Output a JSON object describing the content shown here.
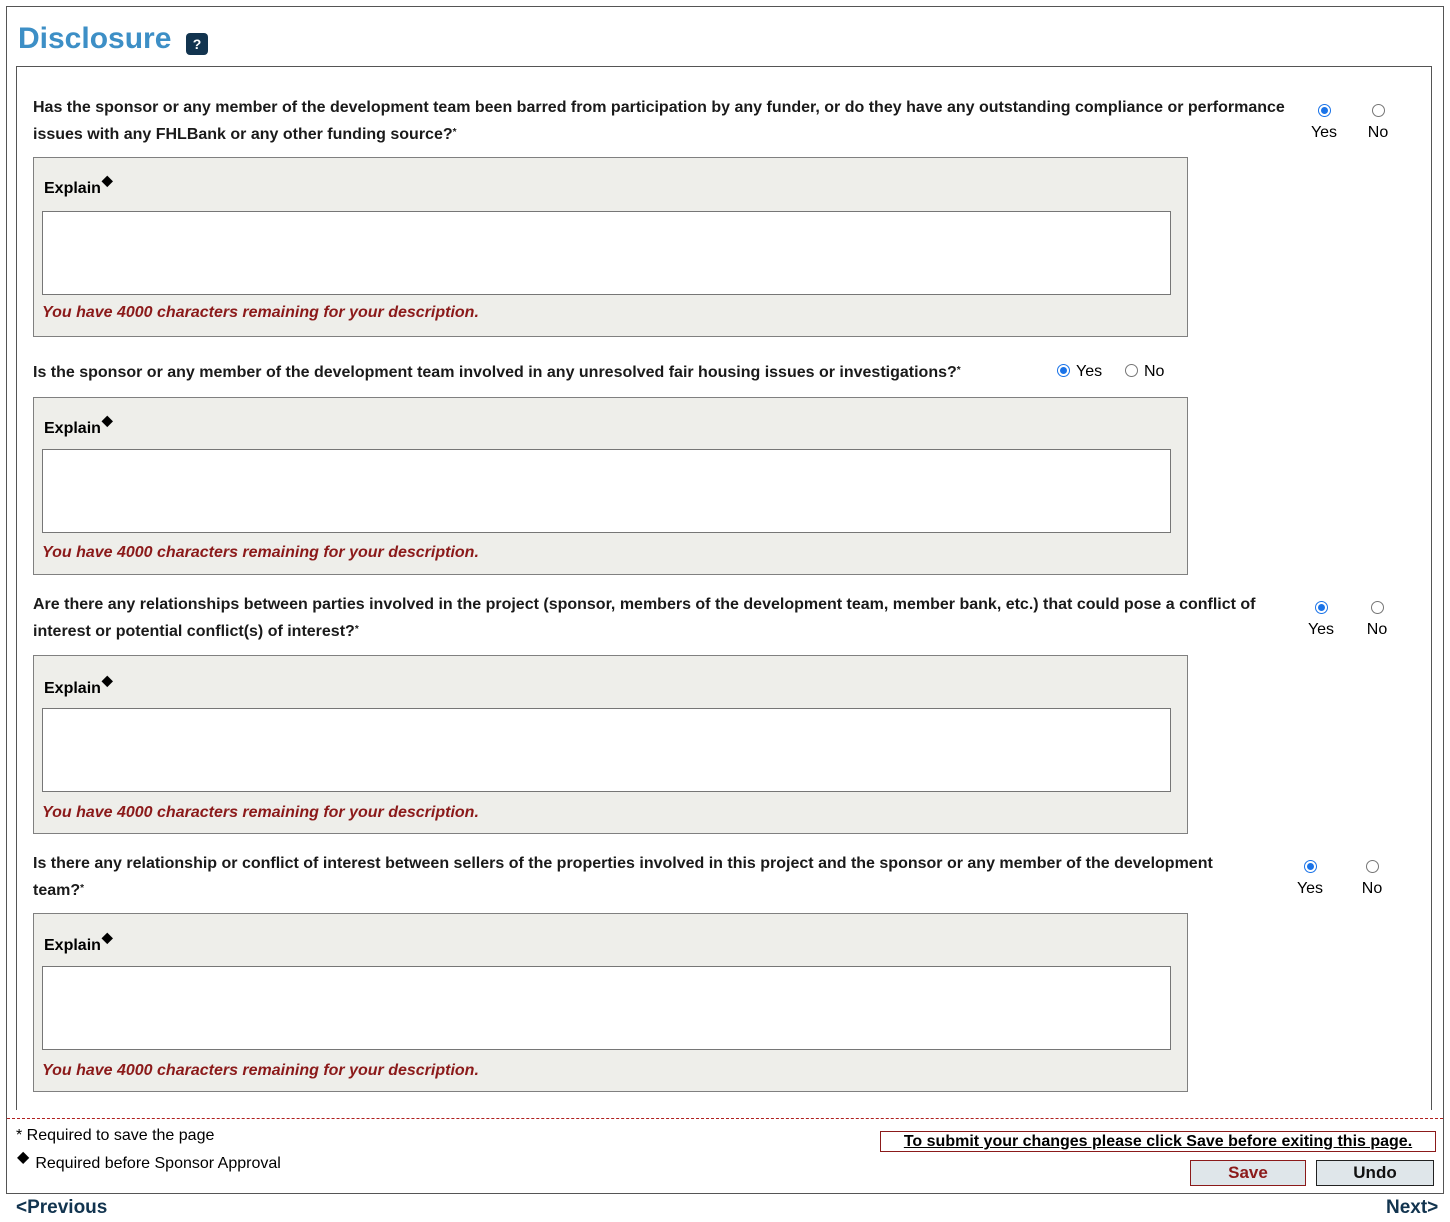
{
  "page": {
    "title": "Disclosure",
    "help_glyph": "?"
  },
  "questions": [
    {
      "text": "Has the sponsor or any member of the development team been barred from participation by any funder, or do they have any outstanding compliance or performance issues with any FHLBank or any other funding source?",
      "required_mark": "*",
      "yes_label": "Yes",
      "no_label": "No",
      "selected": "Yes",
      "explain_label": "Explain",
      "explain_mark": "◆",
      "explain_value": "",
      "remaining": "You have 4000 characters remaining for your description."
    },
    {
      "text": "Is the sponsor or any member of the development team involved in any unresolved fair housing issues or investigations?",
      "required_mark": "*",
      "yes_label": "Yes",
      "no_label": "No",
      "selected": "Yes",
      "explain_label": "Explain",
      "explain_mark": "◆",
      "explain_value": "",
      "remaining": "You have 4000 characters remaining for your description."
    },
    {
      "text": "Are there any relationships between parties involved in the project (sponsor, members of the development team, member bank, etc.) that could pose a conflict of interest or potential conflict(s) of interest?",
      "required_mark": "*",
      "yes_label": "Yes",
      "no_label": "No",
      "selected": "Yes",
      "explain_label": "Explain",
      "explain_mark": "◆",
      "explain_value": "",
      "remaining": "You have 4000 characters remaining for your description."
    },
    {
      "text": "Is there any relationship or conflict of interest between sellers of the properties involved in this project and the sponsor or any member of the development team?",
      "required_mark": "*",
      "yes_label": "Yes",
      "no_label": "No",
      "selected": "Yes",
      "explain_label": "Explain",
      "explain_mark": "◆",
      "explain_value": "",
      "remaining": "You have 4000 characters remaining for your description."
    }
  ],
  "footer": {
    "legend_required_save": "* Required to save the page",
    "legend_mark": "◆",
    "legend_required_approval": "Required before Sponsor Approval",
    "submit_note": "To submit your changes please click Save before exiting this page.",
    "save_label": "Save",
    "undo_label": "Undo"
  },
  "nav": {
    "previous": "<Previous",
    "next": "Next>"
  },
  "colors": {
    "title": "#3d8fc6",
    "accent_red": "#8b1a1a",
    "radio_selected": "#1a73e8",
    "box_bg": "#eeeeea"
  }
}
